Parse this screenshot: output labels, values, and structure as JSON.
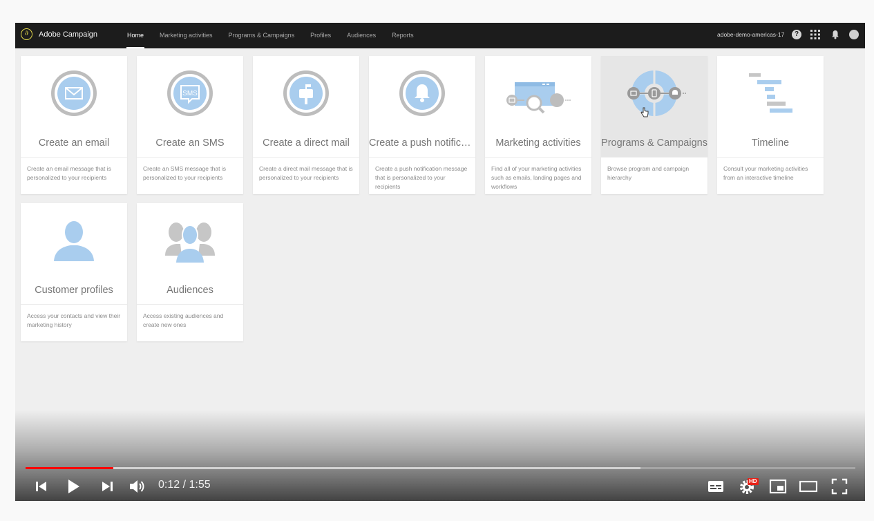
{
  "app": {
    "name": "Adobe Campaign",
    "account": "adobe-demo-americas-17",
    "help": "?"
  },
  "nav": [
    {
      "label": "Home"
    },
    {
      "label": "Marketing activities"
    },
    {
      "label": "Programs & Campaigns"
    },
    {
      "label": "Profiles"
    },
    {
      "label": "Audiences"
    },
    {
      "label": "Reports"
    }
  ],
  "tiles": [
    {
      "title": "Create an email",
      "description": "Create an email message that is personalized to your recipients",
      "icon": "email-icon"
    },
    {
      "title": "Create an SMS",
      "description": "Create an SMS message that is personalized to your recipients",
      "icon": "sms-icon",
      "icon_text": "SMS"
    },
    {
      "title": "Create a direct mail",
      "description": "Create a direct mail message that is personalized to your recipients",
      "icon": "mailbox-icon"
    },
    {
      "title": "Create a push notificati...",
      "description": "Create a push notification message that is personalized to your recipients",
      "icon": "push-bell-icon"
    },
    {
      "title": "Marketing activities",
      "description": "Find all of your marketing activities such as emails, landing pages and workflows",
      "icon": "marketing-activities-icon"
    },
    {
      "title": "Programs & Campaigns",
      "description": "Browse program and campaign hierarchy",
      "icon": "programs-campaigns-icon"
    },
    {
      "title": "Timeline",
      "description": "Consult your marketing activities from an interactive timeline",
      "icon": "timeline-icon"
    },
    {
      "title": "Customer profiles",
      "description": "Access your contacts and view their marketing history",
      "icon": "profile-icon"
    },
    {
      "title": "Audiences",
      "description": "Access existing audiences and create new ones",
      "icon": "audiences-icon"
    }
  ],
  "player": {
    "time_display": "0:12 / 1:55",
    "current_time": "0:12",
    "duration": "1:55",
    "played_fraction": 0.106,
    "buffered_fraction": 0.741,
    "quality_badge": "HD"
  },
  "colors": {
    "accent_blue": "#a9cdee",
    "icon_ring": "#bdbdbd",
    "progress_red": "#ff0000",
    "topbar_bg": "#1c1c1c",
    "logo_yellow": "#e3d94a"
  }
}
